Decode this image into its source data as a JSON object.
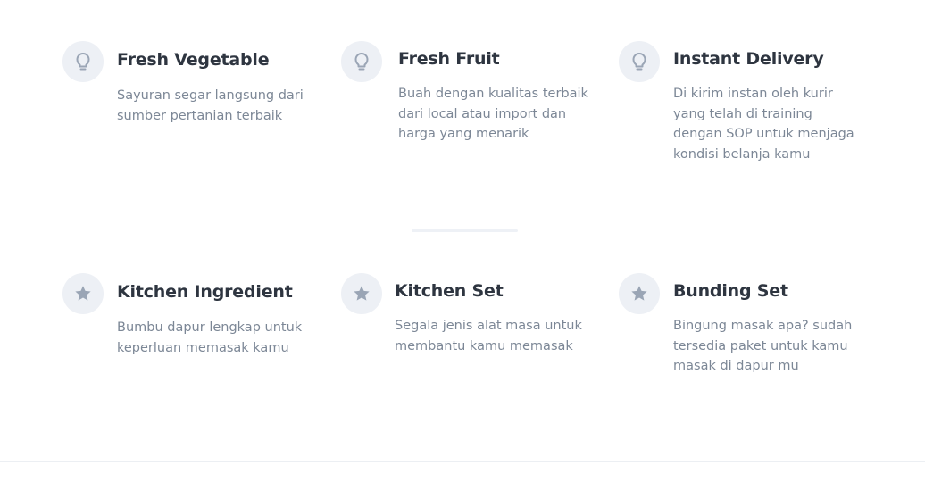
{
  "features_top": [
    {
      "title": "Fresh Vegetable",
      "description": "Sayuran segar langsung dari sumber pertanian terbaik",
      "icon": "lightbulb-icon"
    },
    {
      "title": "Fresh Fruit",
      "description": "Buah dengan kualitas terbaik dari local atau import dan harga yang menarik",
      "icon": "lightbulb-icon"
    },
    {
      "title": "Instant Delivery",
      "description": "Di kirim instan oleh kurir yang telah di training dengan SOP untuk menjaga kondisi belanja kamu",
      "icon": "lightbulb-icon"
    }
  ],
  "features_bottom": [
    {
      "title": "Kitchen Ingredient",
      "description": "Bumbu dapur lengkap untuk keperluan memasak kamu",
      "icon": "star-icon"
    },
    {
      "title": "Kitchen Set",
      "description": "Segala jenis alat masa untuk membantu kamu memasak",
      "icon": "star-icon"
    },
    {
      "title": "Bunding Set",
      "description": "Bingung masak apa? sudah tersedia paket untuk kamu masak di dapur mu",
      "icon": "star-icon"
    }
  ],
  "colors": {
    "icon_bg": "#edf0f5",
    "icon_fg": "#9aa5b5",
    "title": "#2e3540",
    "text": "#7c8796"
  }
}
